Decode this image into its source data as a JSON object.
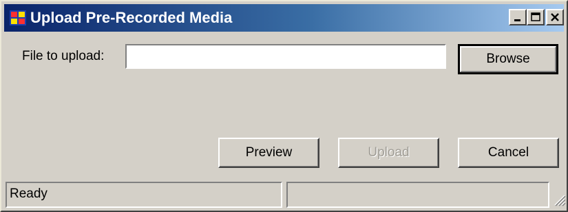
{
  "window": {
    "title": "Upload Pre-Recorded Media",
    "icon": "app-window-icon",
    "controls": [
      "minimize-icon",
      "maximize-icon",
      "close-icon"
    ]
  },
  "form": {
    "file_label": "File to upload:",
    "file_value": "",
    "browse_label": "Browse"
  },
  "actions": {
    "preview_label": "Preview",
    "upload_label": "Upload",
    "upload_enabled": false,
    "cancel_label": "Cancel"
  },
  "statusbar": {
    "status_text": "Ready",
    "secondary_text": ""
  },
  "colors": {
    "face": "#d4d0c8",
    "title_start": "#0a246a",
    "title_end": "#a6caf0"
  }
}
